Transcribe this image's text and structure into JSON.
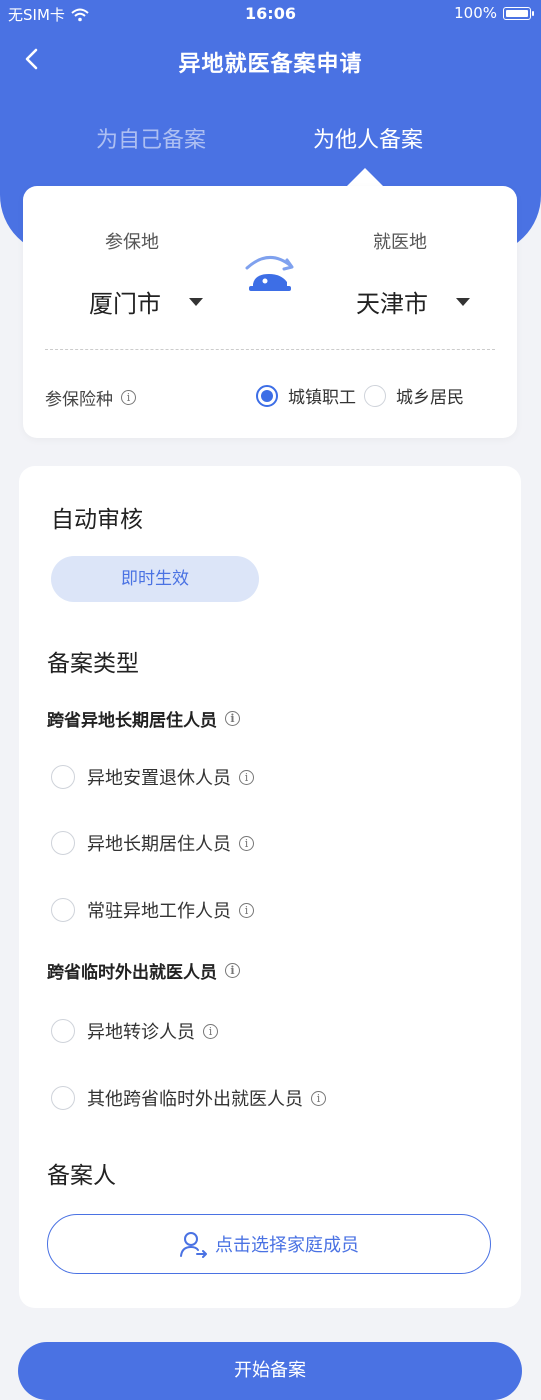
{
  "status_bar": {
    "carrier": "无SIM卡",
    "time": "16:06",
    "battery": "100%"
  },
  "nav": {
    "title": "异地就医备案申请"
  },
  "tabs": {
    "self": "为自己备案",
    "other": "为他人备案"
  },
  "location": {
    "insured_label": "参保地",
    "insured_value": "厦门市",
    "treatment_label": "就医地",
    "treatment_value": "天津市"
  },
  "insurance": {
    "label": "参保险种",
    "option1": "城镇职工",
    "option2": "城乡居民",
    "selected": "城镇职工"
  },
  "audit": {
    "title": "自动审核",
    "badge": "即时生效"
  },
  "record_type": {
    "title": "备案类型",
    "group1": {
      "title": "跨省异地长期居住人员",
      "options": [
        "异地安置退休人员",
        "异地长期居住人员",
        "常驻异地工作人员"
      ]
    },
    "group2": {
      "title": "跨省临时外出就医人员",
      "options": [
        "异地转诊人员",
        "其他跨省临时外出就医人员"
      ]
    }
  },
  "filer": {
    "title": "备案人",
    "select_button": "点击选择家庭成员"
  },
  "start_button": "开始备案",
  "colors": {
    "primary": "#4a72e3",
    "badge_bg": "#dce5f8",
    "background": "#f2f3f7"
  },
  "icons": [
    "wifi-icon",
    "battery-icon",
    "back-icon",
    "switch-location-icon",
    "info-icon",
    "person-select-icon"
  ]
}
